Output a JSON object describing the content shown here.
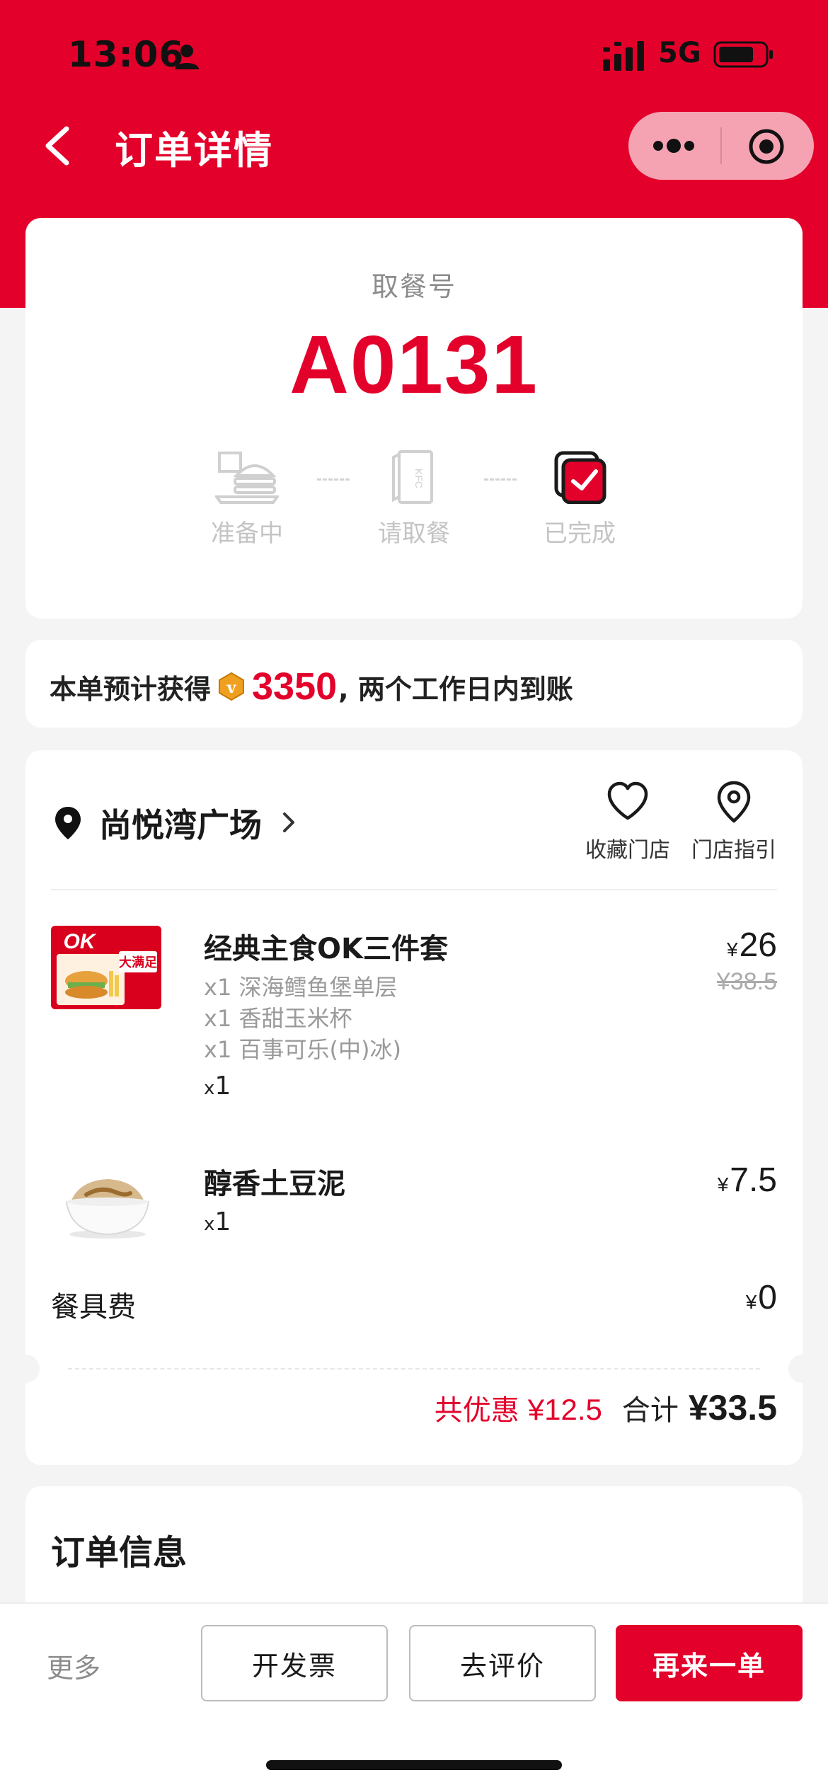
{
  "status_bar": {
    "time": "13:06",
    "network": "5G"
  },
  "nav": {
    "title": "订单详情"
  },
  "pickup": {
    "label": "取餐号",
    "number": "A0131",
    "steps": [
      {
        "label": "准备中",
        "state": "inactive"
      },
      {
        "label": "请取餐",
        "state": "inactive"
      },
      {
        "label": "已完成",
        "state": "active"
      }
    ]
  },
  "points": {
    "prefix": "本单预计获得",
    "value": "3350",
    "suffix": ", 两个工作日内到账"
  },
  "store": {
    "name": "尚悦湾广场",
    "favorite_label": "收藏门店",
    "guide_label": "门店指引"
  },
  "items": [
    {
      "name": "经典主食OK三件套",
      "subitems": [
        "x1 深海鳕鱼堡单层",
        "x1 香甜玉米杯",
        "x1 百事可乐(中)冰)"
      ],
      "qty_x": "x",
      "qty_n": "1",
      "currency": "¥",
      "price": "26",
      "original_price": "¥38.5",
      "thumb_text": "OK",
      "thumb_badge": "大满足"
    },
    {
      "name": "醇香土豆泥",
      "qty_x": "x",
      "qty_n": "1",
      "currency": "¥",
      "price": "7.5"
    }
  ],
  "fee": {
    "label": "餐具费",
    "currency": "¥",
    "value": "0"
  },
  "totals": {
    "discount_label": "共优惠",
    "discount_value": "¥12.5",
    "total_label": "合计",
    "total_value": "¥33.5"
  },
  "info": {
    "title": "订单信息"
  },
  "bottom_bar": {
    "more": "更多",
    "invoice": "开发票",
    "review": "去评价",
    "reorder": "再来一单"
  },
  "colors": {
    "brand": "#e3002b",
    "capsule": "#f5a3b3",
    "background": "#f4f4f5"
  }
}
